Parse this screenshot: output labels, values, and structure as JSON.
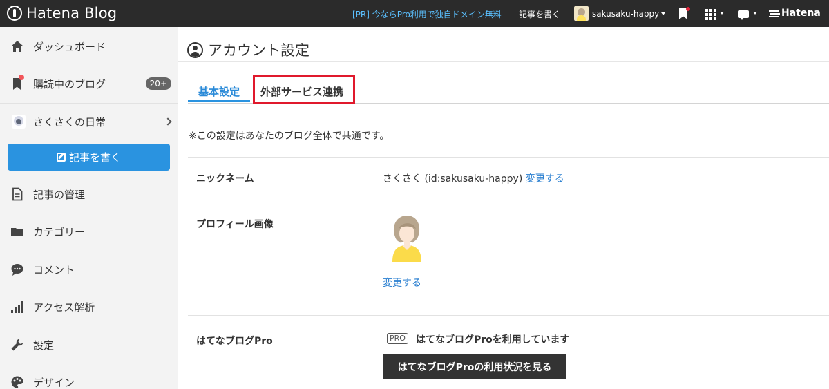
{
  "header": {
    "logo_text": "Hatena Blog",
    "pr_link": "[PR] 今ならPro利用で独自ドメイン無料",
    "write_link": "記事を書く",
    "user_name": "sakusaku-happy",
    "hatena_label": "Hatena"
  },
  "sidebar": {
    "items": [
      {
        "label": "ダッシュボード",
        "icon": "home-icon"
      },
      {
        "label": "購読中のブログ",
        "icon": "bookmark-icon",
        "badge": "20+"
      },
      {
        "label": "さくさくの日常",
        "icon": "blog-avatar"
      },
      {
        "label": "記事の管理",
        "icon": "document-icon"
      },
      {
        "label": "カテゴリー",
        "icon": "folder-icon"
      },
      {
        "label": "コメント",
        "icon": "comment-icon"
      },
      {
        "label": "アクセス解析",
        "icon": "bar-chart-icon"
      },
      {
        "label": "設定",
        "icon": "wrench-icon"
      },
      {
        "label": "デザイン",
        "icon": "palette-icon"
      }
    ],
    "write_button": "記事を書く"
  },
  "main": {
    "page_title": "アカウント設定",
    "tabs": [
      {
        "label": "基本設定",
        "active": true
      },
      {
        "label": "外部サービス連携",
        "active": false
      }
    ],
    "notice": "※この設定はあなたのブログ全体で共通です。",
    "rows": {
      "nickname": {
        "label": "ニックネーム",
        "value": "さくさく (id:sakusaku-happy)",
        "link": "変更する"
      },
      "profile": {
        "label": "プロフィール画像",
        "link": "変更する"
      },
      "pro": {
        "label": "はてなブログPro",
        "badge": "PRO",
        "status": "はてなブログProを利用しています",
        "button": "はてなブログProの利用状況を見る"
      }
    }
  },
  "colors": {
    "topbar": "#2b2b2b",
    "accent": "#2a93e0",
    "link": "#2a7fd0",
    "highlight": "#e0192c",
    "sidebar_bg": "#f3f3f3"
  }
}
